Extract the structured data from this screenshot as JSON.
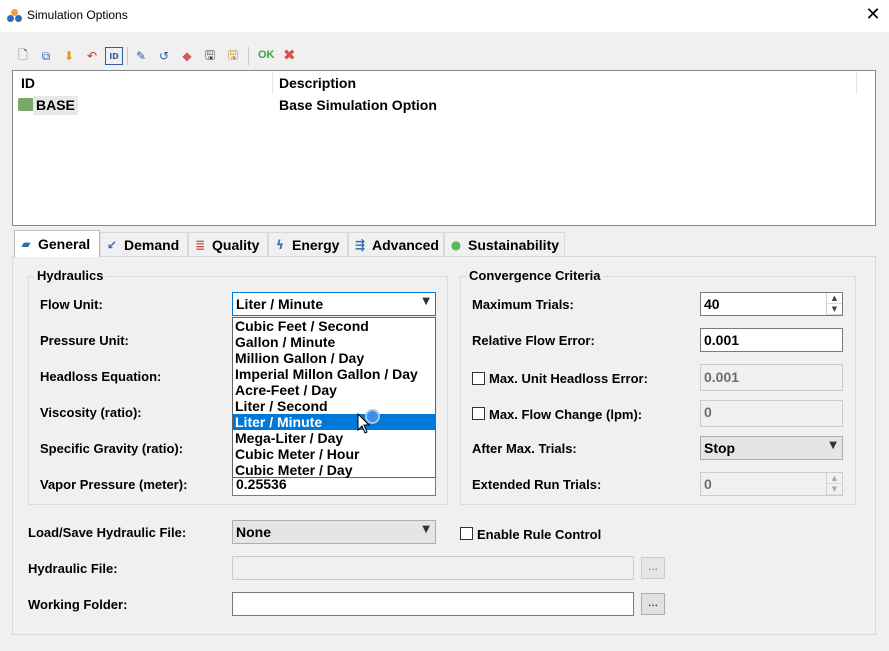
{
  "window": {
    "title": "Simulation Options",
    "close_glyph": "✕"
  },
  "toolbar": {
    "icons": [
      "new-icon",
      "copy-icon",
      "import-icon",
      "undo-icon",
      "id-icon",
      "edit-icon",
      "revert-icon",
      "erase-icon",
      "save-icon",
      "save-all-icon"
    ],
    "ok_label": "OK",
    "cancel_glyph": "✖"
  },
  "list": {
    "headers": {
      "id": "ID",
      "description": "Description"
    },
    "rows": [
      {
        "id": "BASE",
        "description": "Base Simulation Option"
      }
    ]
  },
  "tabs": [
    {
      "label": "General",
      "icon": "general-icon",
      "active": true
    },
    {
      "label": "Demand",
      "icon": "demand-icon"
    },
    {
      "label": "Quality",
      "icon": "quality-icon"
    },
    {
      "label": "Energy",
      "icon": "energy-icon"
    },
    {
      "label": "Advanced",
      "icon": "advanced-icon"
    },
    {
      "label": "Sustainability",
      "icon": "sustainability-icon"
    }
  ],
  "hydraulics": {
    "title": "Hydraulics",
    "flow_unit_label": "Flow Unit:",
    "flow_unit_value": "Liter / Minute",
    "pressure_unit_label": "Pressure Unit:",
    "headloss_label": "Headloss Equation:",
    "viscosity_label": "Viscosity (ratio):",
    "specific_gravity_label": "Specific Gravity (ratio):",
    "vapor_pressure_label": "Vapor Pressure (meter):",
    "vapor_pressure_value": "0.25536",
    "flow_unit_options": [
      "Cubic Feet / Second",
      "Gallon / Minute",
      "Million Gallon / Day",
      "Imperial Millon Gallon / Day",
      "Acre-Feet / Day",
      "Liter / Second",
      "Liter / Minute",
      "Mega-Liter / Day",
      "Cubic Meter / Hour",
      "Cubic Meter / Day"
    ],
    "selected_option": "Liter / Minute"
  },
  "convergence": {
    "title": "Convergence Criteria",
    "max_trials_label": "Maximum Trials:",
    "max_trials_value": "40",
    "rel_flow_error_label": "Relative Flow Error:",
    "rel_flow_error_value": "0.001",
    "max_unit_headloss_label": "Max. Unit Headloss Error:",
    "max_unit_headloss_value": "0.001",
    "max_unit_headloss_checked": false,
    "max_flow_change_label": "Max. Flow Change (lpm):",
    "max_flow_change_value": "0",
    "max_flow_change_checked": false,
    "after_max_trials_label": "After Max. Trials:",
    "after_max_trials_value": "Stop",
    "extended_run_label": "Extended Run Trials:",
    "extended_run_value": "0"
  },
  "bottom": {
    "load_save_label": "Load/Save Hydraulic File:",
    "load_save_value": "None",
    "enable_rule_label": "Enable Rule Control",
    "enable_rule_checked": false,
    "hydraulic_file_label": "Hydraulic File:",
    "hydraulic_file_value": "",
    "working_folder_label": "Working Folder:",
    "working_folder_value": "",
    "browse_label": "..."
  },
  "colors": {
    "selection": "#0078d7",
    "ok": "#3aa53a",
    "cancel": "#e04a4a",
    "focus_border": "#0078d7"
  }
}
